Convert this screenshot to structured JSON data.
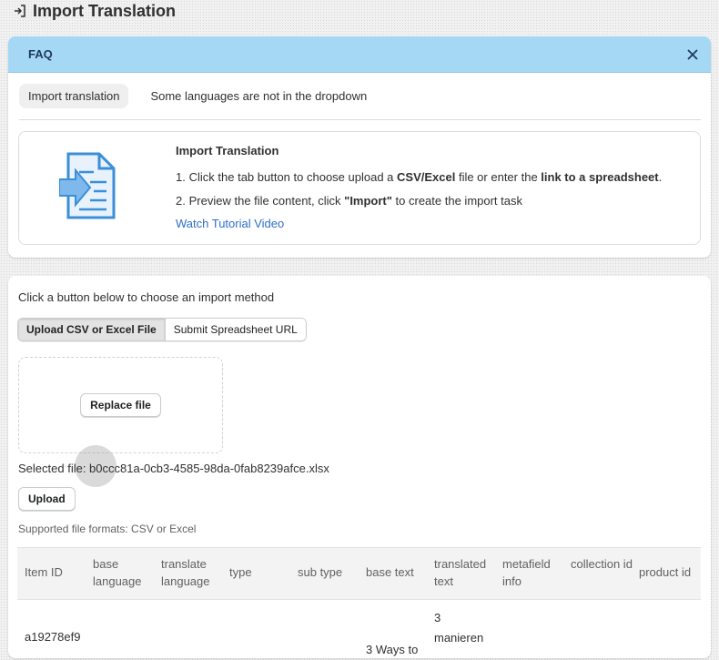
{
  "header": {
    "title": "Import Translation",
    "icon": "import-icon"
  },
  "faq": {
    "title": "FAQ",
    "close_icon": "close-icon",
    "tabs": [
      {
        "label": "Import translation",
        "active": true
      },
      {
        "label": "Some languages are not in the dropdown",
        "active": false
      }
    ],
    "guide": {
      "heading": "Import Translation",
      "step1": {
        "n": "1.",
        "pre": "Click the tab button to choose upload a ",
        "bold1": "CSV/Excel",
        "mid": " file or enter the ",
        "bold2": "link to a spreadsheet",
        "post": "."
      },
      "step2": {
        "n": "2.",
        "pre": "Preview the file content, click ",
        "bold": "\"Import\"",
        "post": " to create the import task"
      },
      "link": "Watch Tutorial Video"
    }
  },
  "main": {
    "method_label": "Click a button below to choose an import method",
    "methods": [
      {
        "label": "Upload CSV or Excel File",
        "active": true
      },
      {
        "label": "Submit Spreadsheet URL",
        "active": false
      }
    ],
    "replace_label": "Replace file",
    "selected_prefix": "Selected file: ",
    "selected_file": "b0ccc81a-0cb3-4585-98da-0fab8239afce.xlsx",
    "upload_label": "Upload",
    "formats": "Supported file formats: CSV or Excel"
  },
  "table": {
    "columns": [
      "Item ID",
      "base language",
      "translate language",
      "type",
      "sub type",
      "base text",
      "translated text",
      "metafield info",
      "collection id",
      "product id"
    ],
    "rows": [
      {
        "item_id": "a19278ef9",
        "base_text": "3 Ways to",
        "translated_text": "3 manieren"
      }
    ]
  },
  "colors": {
    "faq_bar": "#a4d8f5",
    "link": "#2c6ecb",
    "illustration": "#3b8fd8"
  }
}
